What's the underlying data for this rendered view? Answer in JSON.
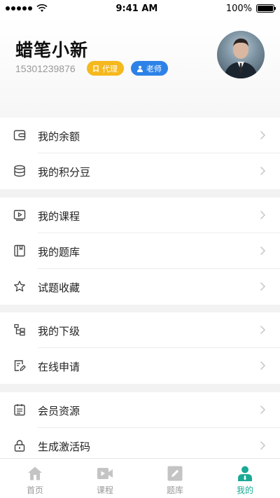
{
  "status_bar": {
    "time": "9:41 AM",
    "battery": "100%"
  },
  "profile": {
    "name": "蜡笔小新",
    "phone": "15301239876",
    "badges": [
      "代理",
      "老师"
    ],
    "avatar_icon": "avatar"
  },
  "menu": {
    "balance": "我的余额",
    "points": "我的积分豆",
    "courses": "我的课程",
    "question_bank": "我的题库",
    "favorites": "试题收藏",
    "subordinates": "我的下级",
    "apply": "在线申请",
    "member_resources": "会员资源",
    "activation_code": "生成激活码"
  },
  "tabs": {
    "home": "首页",
    "courses": "课程",
    "question_bank": "题库",
    "mine": "我的"
  },
  "colors": {
    "accent": "#1aaa96",
    "agent_badge": "#f5b81d",
    "teacher_badge": "#2d82e8",
    "tab_inactive": "#c4c4c4"
  }
}
